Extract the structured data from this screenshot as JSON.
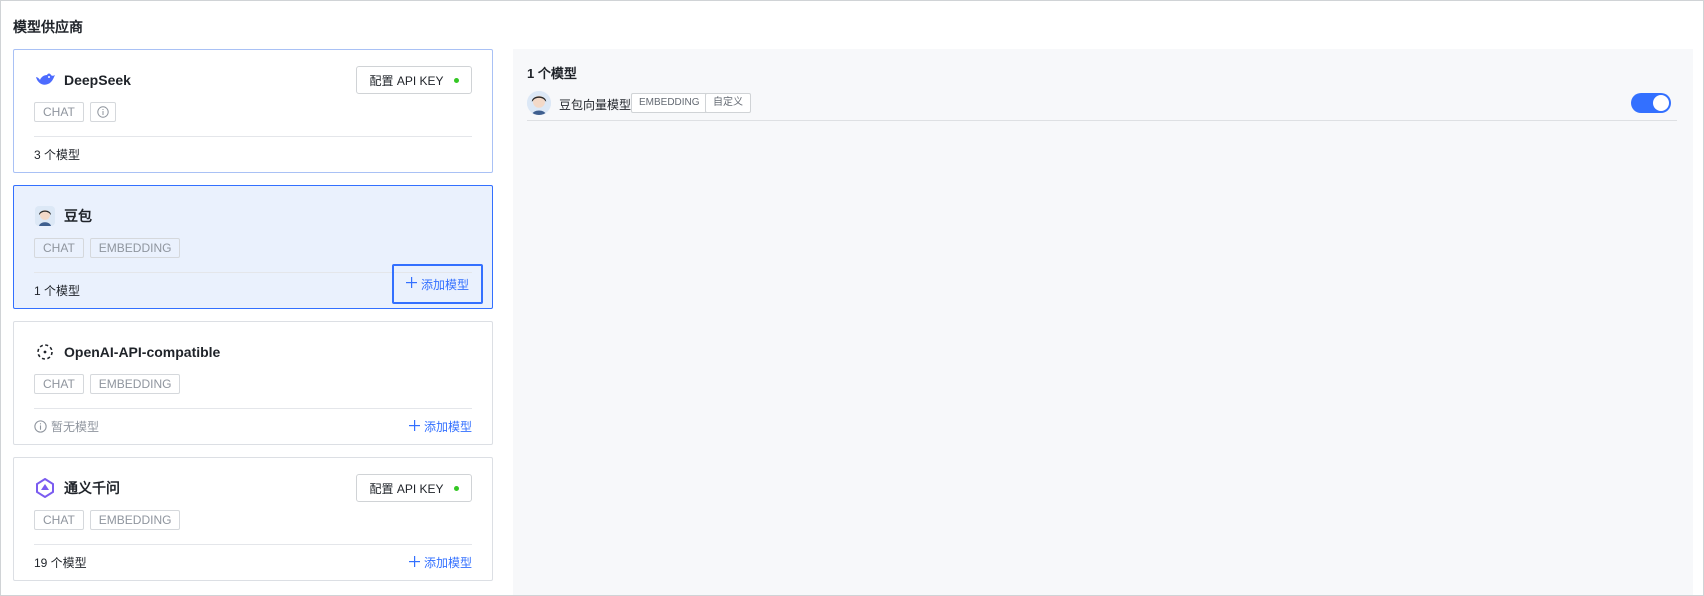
{
  "page_title": "模型供应商",
  "colors": {
    "accent": "#3370ff",
    "status_dot": "#34c724"
  },
  "providers": [
    {
      "name": "DeepSeek",
      "icon": "deepseek-whale-icon",
      "tags": [
        "CHAT"
      ],
      "api_button": "配置 API KEY",
      "count_label": "3 个模型"
    },
    {
      "name": "豆包",
      "icon": "doubao-avatar-icon",
      "tags": [
        "CHAT",
        "EMBEDDING"
      ],
      "count_label": "1 个模型",
      "add_label": "添加模型"
    },
    {
      "name": "OpenAI-API-compatible",
      "icon": "openai-compatible-icon",
      "tags": [
        "CHAT",
        "EMBEDDING"
      ],
      "empty_label": "暂无模型",
      "add_label": "添加模型"
    },
    {
      "name": "通义千问",
      "icon": "tongyi-icon",
      "tags": [
        "CHAT",
        "EMBEDDING"
      ],
      "api_button": "配置 API KEY",
      "count_label": "19 个模型",
      "add_label": "添加模型"
    }
  ],
  "detail": {
    "title": "1 个模型",
    "models": [
      {
        "name": "豆包向量模型",
        "tags": [
          "EMBEDDING",
          "自定义"
        ],
        "enabled": true
      }
    ]
  }
}
